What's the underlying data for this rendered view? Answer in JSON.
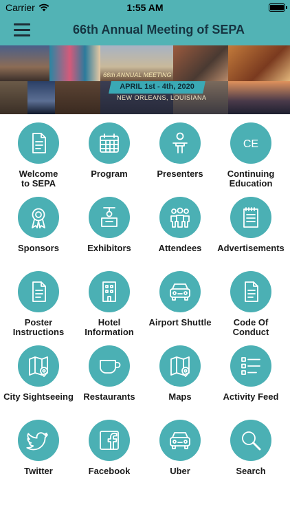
{
  "status_bar": {
    "carrier": "Carrier",
    "time": "1:55 AM"
  },
  "header": {
    "title": "66th Annual Meeting of SEPA"
  },
  "banner": {
    "ribbon_main": "APRIL 1st - 4th, 2020",
    "ribbon_sub": "NEW ORLEANS, LOUISIANA",
    "arc": "66th ANNUAL MEETING"
  },
  "colors": {
    "accent": "#4bb0b4",
    "header": "#52b3b5"
  },
  "menu": [
    {
      "label": "Welcome\nto SEPA",
      "icon": "document-icon"
    },
    {
      "label": "Program",
      "icon": "calendar-icon"
    },
    {
      "label": "Presenters",
      "icon": "presenter-icon"
    },
    {
      "label": "Continuing\nEducation",
      "icon": "ce-icon"
    },
    {
      "label": "Sponsors",
      "icon": "ribbon-award-icon"
    },
    {
      "label": "Exhibitors",
      "icon": "booth-icon"
    },
    {
      "label": "Attendees",
      "icon": "people-icon"
    },
    {
      "label": "Advertisements",
      "icon": "notepad-icon"
    },
    {
      "label": "Poster\nInstructions",
      "icon": "document-icon"
    },
    {
      "label": "Hotel\nInformation",
      "icon": "building-icon"
    },
    {
      "label": "Airport Shuttle",
      "icon": "car-icon"
    },
    {
      "label": "Code Of\nConduct",
      "icon": "document-icon"
    },
    {
      "label": "City Sightseeing",
      "icon": "map-icon"
    },
    {
      "label": "Restaurants",
      "icon": "cup-icon"
    },
    {
      "label": "Maps",
      "icon": "map-icon"
    },
    {
      "label": "Activity Feed",
      "icon": "list-icon"
    },
    {
      "label": "Twitter",
      "icon": "twitter-icon"
    },
    {
      "label": "Facebook",
      "icon": "facebook-icon"
    },
    {
      "label": "Uber",
      "icon": "car-icon"
    },
    {
      "label": "Search",
      "icon": "search-icon"
    }
  ]
}
